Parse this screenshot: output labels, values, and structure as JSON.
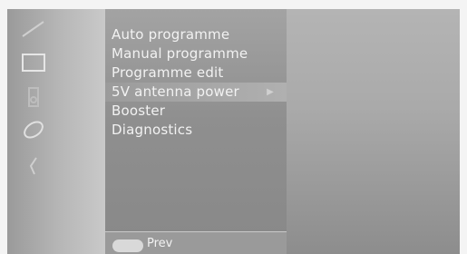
{
  "rail": {
    "icons": [
      "picture-icon",
      "sound-icon",
      "time-icon",
      "special-icon",
      "setup-icon"
    ]
  },
  "menu": {
    "items": [
      {
        "label": "Auto programme"
      },
      {
        "label": "Manual programme"
      },
      {
        "label": "Programme edit"
      },
      {
        "label": "5V antenna power",
        "arrow": "▶"
      },
      {
        "label": "Booster"
      },
      {
        "label": "Diagnostics"
      }
    ],
    "active_index": 3
  },
  "footer": {
    "prev_label": "Prev"
  },
  "colors": {
    "menu_text": "#f2f2f2",
    "panel": "#8f8f8f",
    "background": "#a9a9a9"
  }
}
